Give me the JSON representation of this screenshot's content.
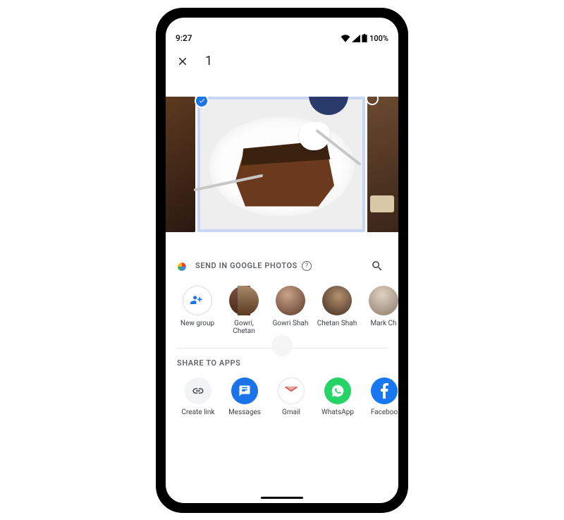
{
  "status": {
    "time": "9:27",
    "battery": "100%"
  },
  "header": {
    "selected_count": "1"
  },
  "send_section": {
    "label": "SEND IN GOOGLE PHOTOS"
  },
  "contacts": [
    {
      "label": "New group"
    },
    {
      "label": "Gowri, Chetan"
    },
    {
      "label": "Gowri Shah"
    },
    {
      "label": "Chetan Shah"
    },
    {
      "label": "Mark Ch"
    }
  ],
  "apps_section": {
    "label": "SHARE TO APPS"
  },
  "apps": [
    {
      "label": "Create link"
    },
    {
      "label": "Messages"
    },
    {
      "label": "Gmail"
    },
    {
      "label": "WhatsApp"
    },
    {
      "label": "Faceboo"
    }
  ]
}
